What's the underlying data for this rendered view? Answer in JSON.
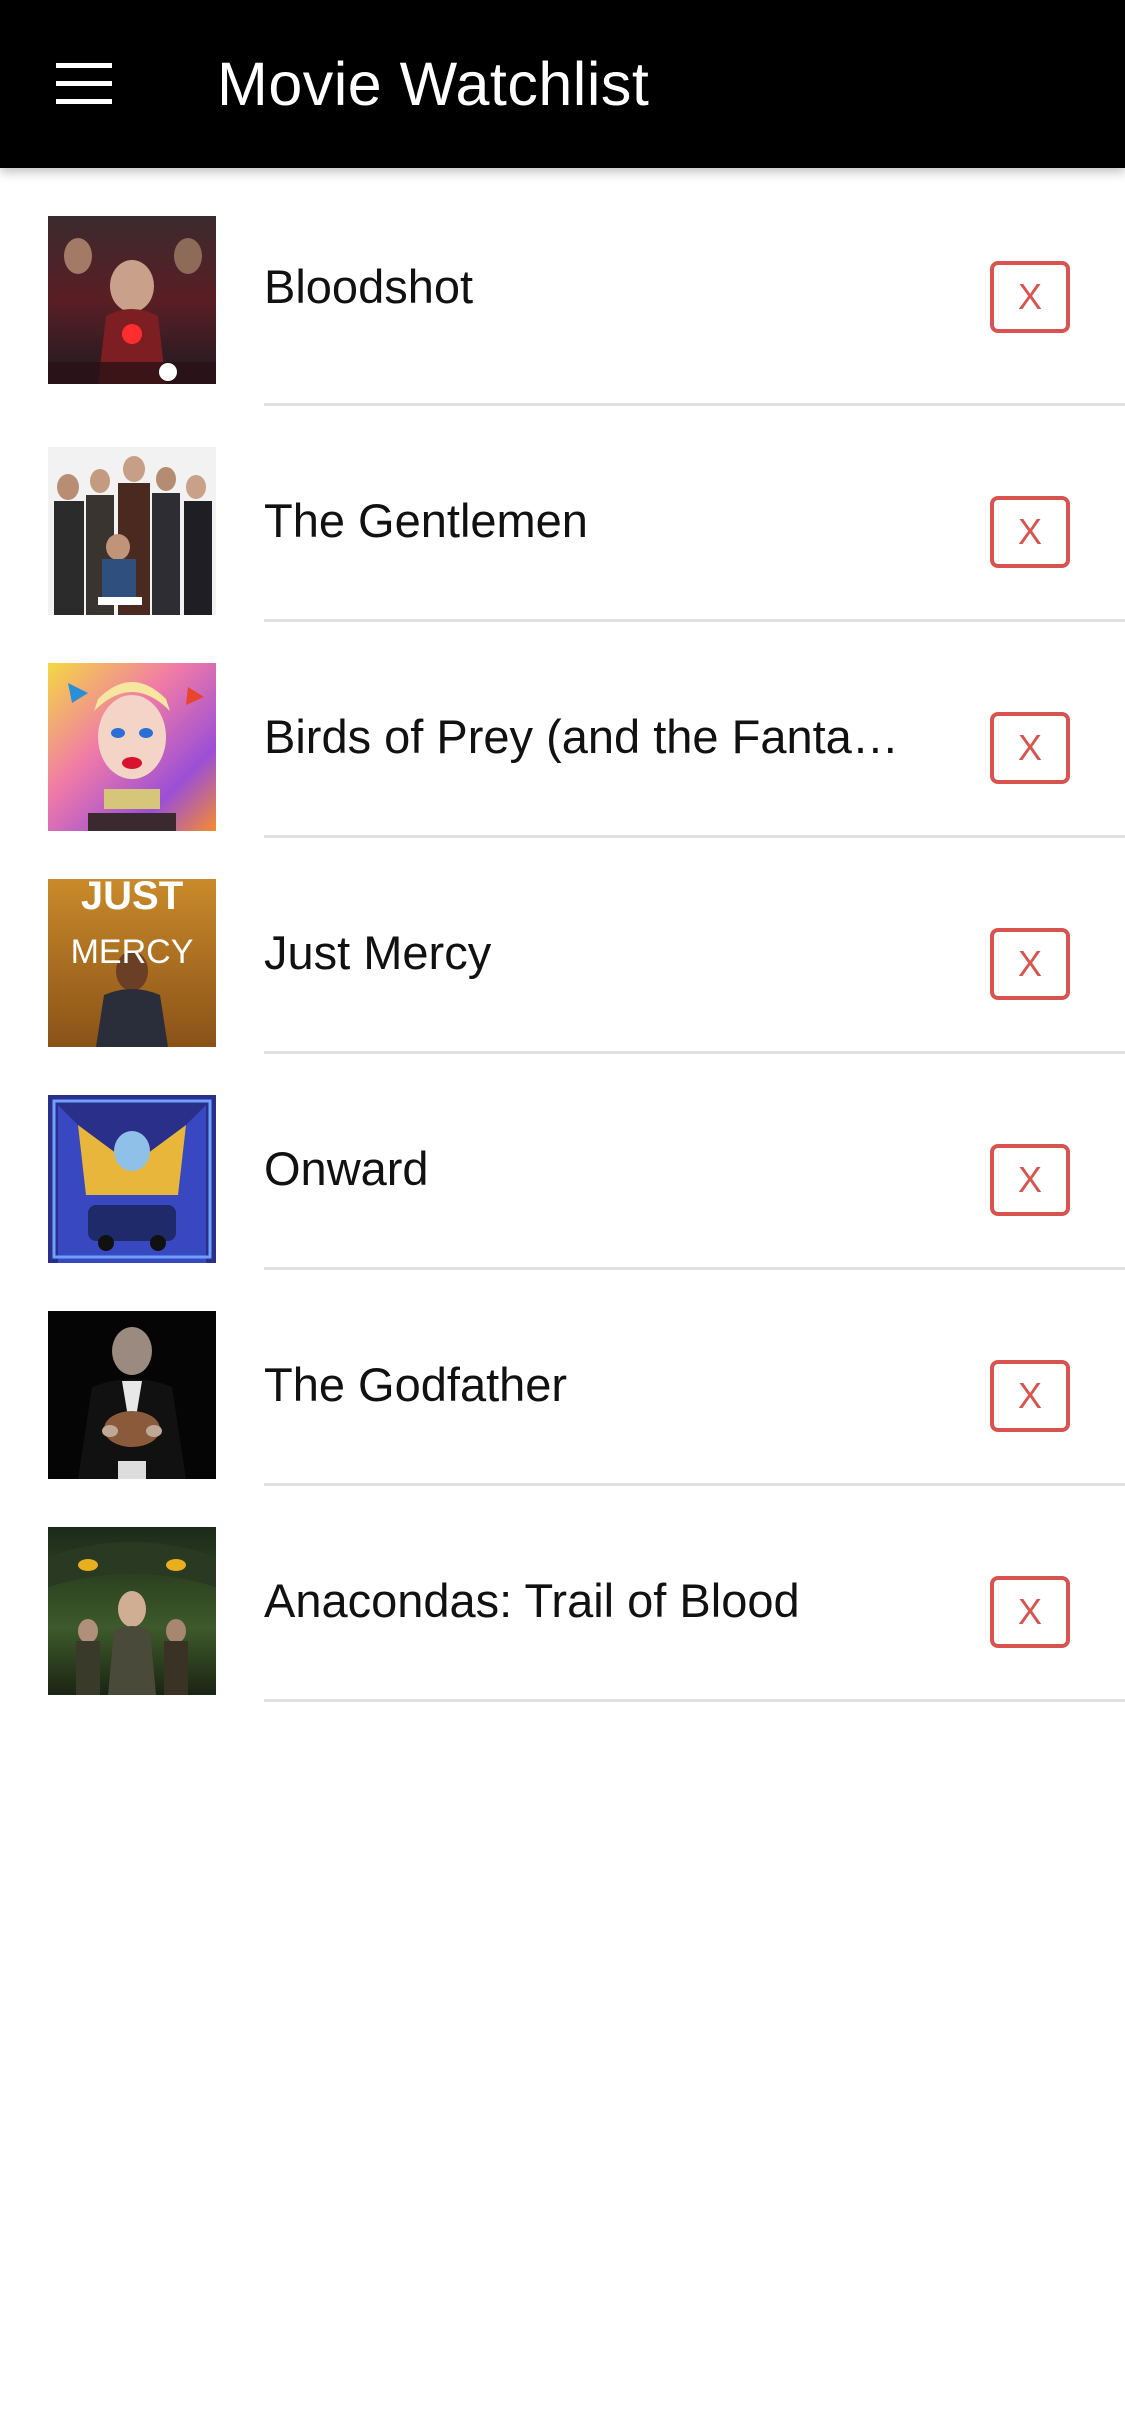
{
  "app_bar": {
    "title": "Movie Watchlist",
    "menu_icon": "hamburger-menu-icon",
    "background": "#000000"
  },
  "accent_color": "#d9534f",
  "movies": [
    {
      "title": "Bloodshot",
      "remove_label": "X"
    },
    {
      "title": "The Gentlemen",
      "remove_label": "X"
    },
    {
      "title": "Birds of Prey (and the Fantabulous Emancipation of One Harley Quinn)",
      "remove_label": "X"
    },
    {
      "title": "Just Mercy",
      "remove_label": "X",
      "poster_text": [
        "JUST",
        "MERCY"
      ]
    },
    {
      "title": "Onward",
      "remove_label": "X"
    },
    {
      "title": "The Godfather",
      "remove_label": "X"
    },
    {
      "title": "Anacondas: Trail of Blood",
      "remove_label": "X"
    }
  ]
}
